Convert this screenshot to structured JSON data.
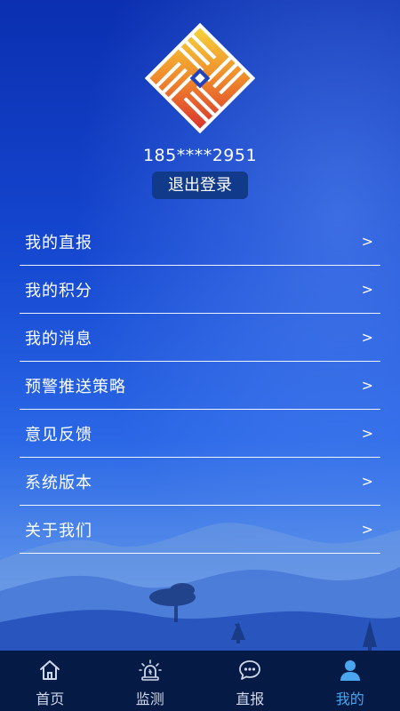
{
  "profile": {
    "phone": "185****2951",
    "logout_label": "退出登录"
  },
  "menu": {
    "items": [
      {
        "label": "我的直报",
        "arrow": ">"
      },
      {
        "label": "我的积分",
        "arrow": ">"
      },
      {
        "label": "我的消息",
        "arrow": ">"
      },
      {
        "label": "预警推送策略",
        "arrow": ">"
      },
      {
        "label": "意见反馈",
        "arrow": ">"
      },
      {
        "label": "系统版本",
        "arrow": ">"
      },
      {
        "label": "关于我们",
        "arrow": ">"
      }
    ]
  },
  "tabbar": {
    "tabs": [
      {
        "label": "首页",
        "icon": "home-icon"
      },
      {
        "label": "监测",
        "icon": "alarm-icon"
      },
      {
        "label": "直报",
        "icon": "chat-icon"
      },
      {
        "label": "我的",
        "icon": "user-icon",
        "active": true
      }
    ],
    "active_color": "#4aa6ee",
    "background": "#061a46"
  }
}
